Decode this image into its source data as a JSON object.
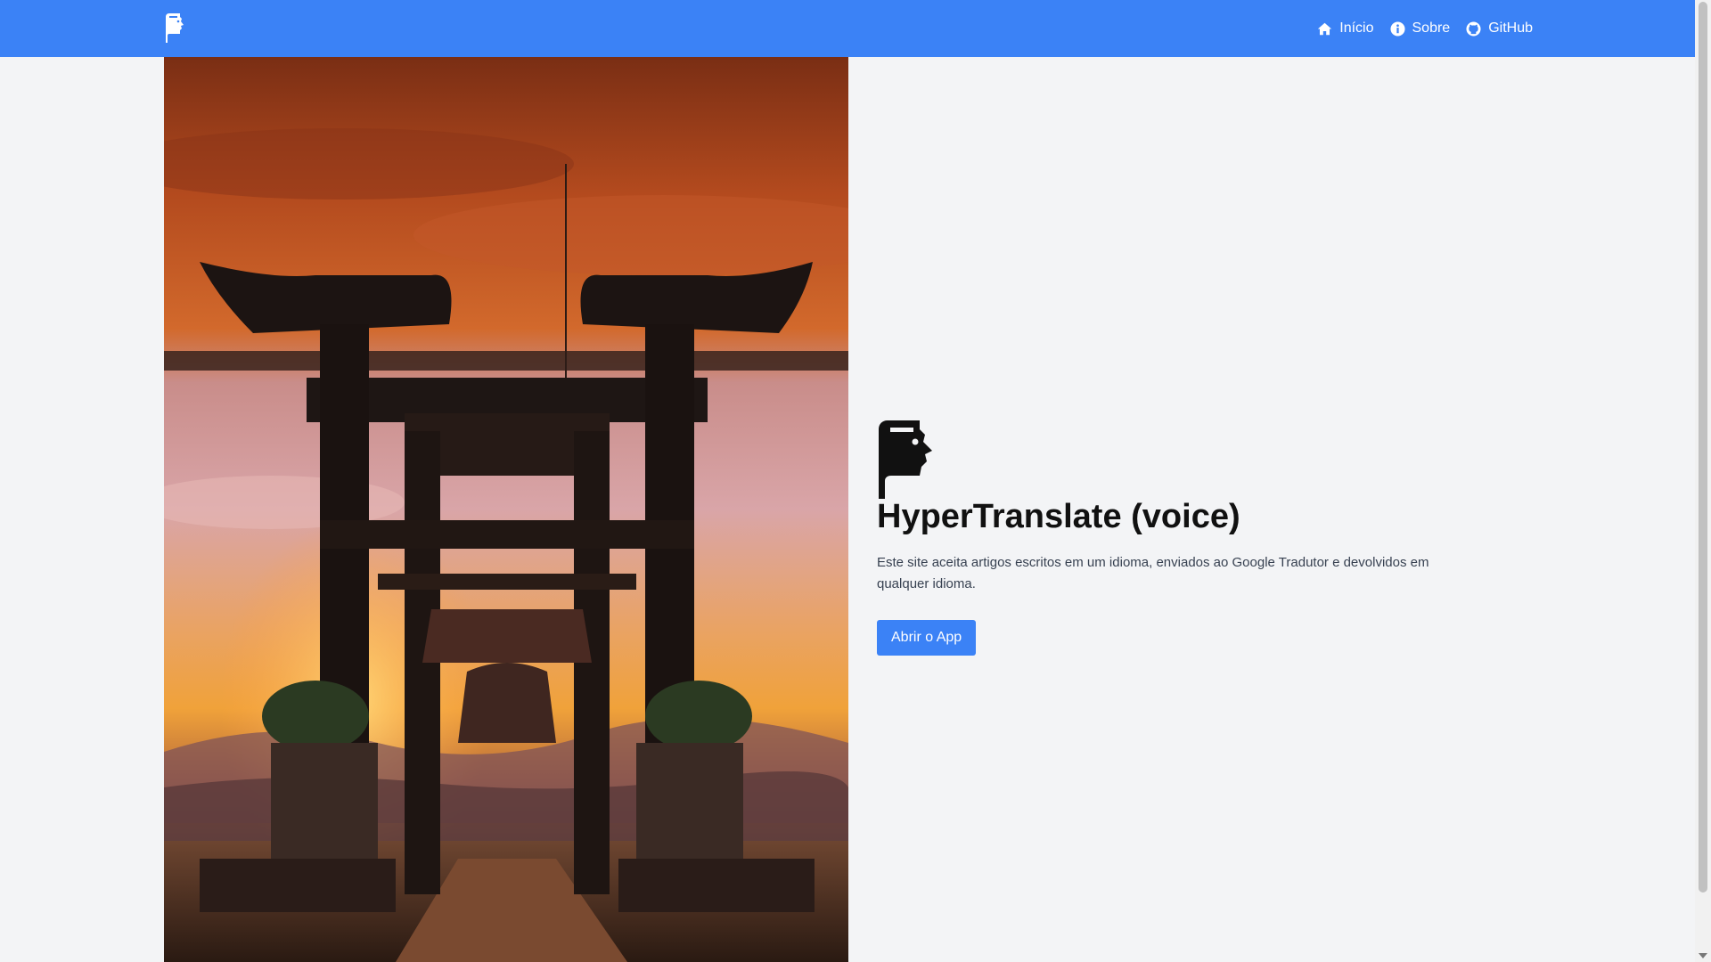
{
  "nav": {
    "logo_icon": "book-head-icon",
    "links": [
      {
        "label": "Início",
        "icon": "home-icon"
      },
      {
        "label": "Sobre",
        "icon": "info-circle-icon"
      },
      {
        "label": "GitHub",
        "icon": "github-icon"
      }
    ]
  },
  "hero": {
    "image_description": "temple-gate-sunset",
    "logo_icon": "book-head-icon",
    "title": "HyperTranslate (voice)",
    "description": "Este site aceita artigos escritos em um idioma, enviados ao Google Tradutor e devolvidos em qualquer idioma.",
    "button_label": "Abrir o App"
  },
  "colors": {
    "primary": "#3b82f6",
    "background": "#f3f4f6"
  }
}
